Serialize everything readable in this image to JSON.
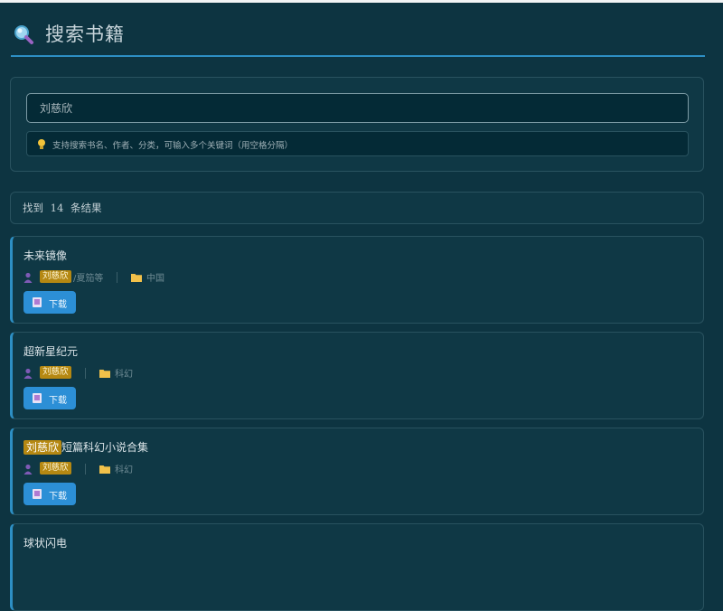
{
  "page": {
    "title": "搜索书籍",
    "accent": "#2d8fc4",
    "highlight": "#b58812"
  },
  "search": {
    "value": "刘慈欣",
    "hint": "支持搜索书名、作者、分类，可输入多个关键词（用空格分隔）"
  },
  "results": {
    "prefix": "找到",
    "count": "14",
    "suffix": "条结果"
  },
  "books": [
    {
      "title_hl": "",
      "title_rest": "未来镜像",
      "author_hl": "刘慈欣",
      "author_rest": "/夏笳等",
      "category": "中国",
      "download": "下载"
    },
    {
      "title_hl": "",
      "title_rest": "超新星纪元",
      "author_hl": "刘慈欣",
      "author_rest": "",
      "category": "科幻",
      "download": "下载"
    },
    {
      "title_hl": "刘慈欣",
      "title_rest": "短篇科幻小说合集",
      "author_hl": "刘慈欣",
      "author_rest": "",
      "category": "科幻",
      "download": "下载"
    },
    {
      "title_hl": "",
      "title_rest": "球状闪电"
    }
  ],
  "icons": {
    "search": "magnifier-icon",
    "hint": "lightbulb-icon",
    "author": "person-icon",
    "category": "folder-icon",
    "download": "book-icon"
  }
}
